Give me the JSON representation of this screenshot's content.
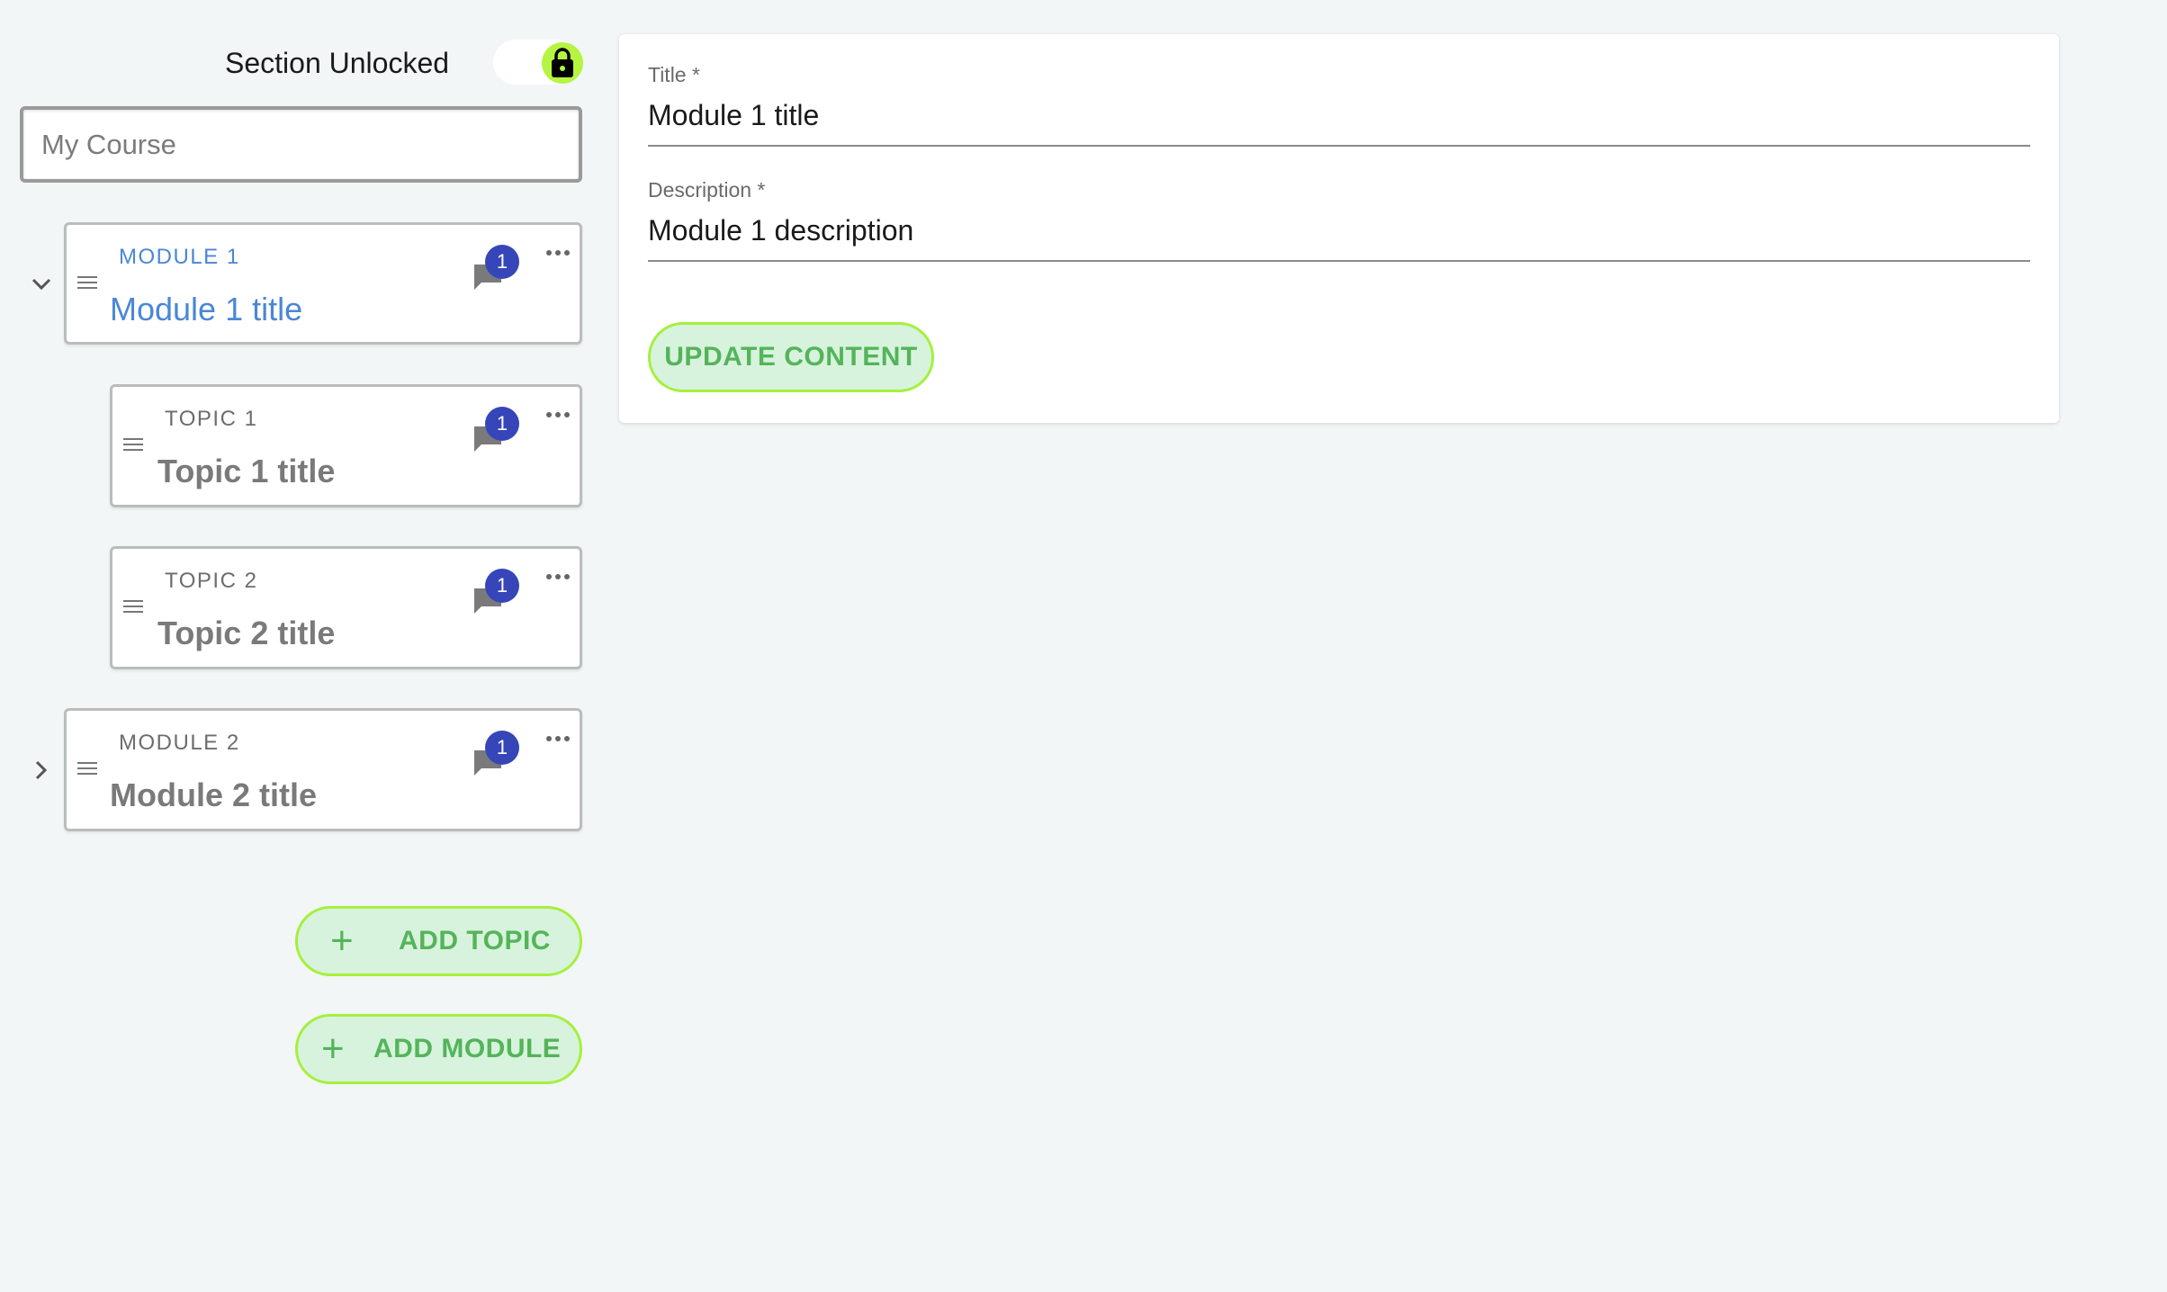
{
  "section": {
    "label": "Section Unlocked",
    "toggle_icon": "lock-icon",
    "toggle_color": "#b5f542"
  },
  "course_input": {
    "placeholder": "My Course",
    "value": ""
  },
  "tree": [
    {
      "overline": "MODULE 1",
      "title": "Module 1 title",
      "comment_count": "1",
      "expanded": true,
      "selected": true
    },
    {
      "overline": "TOPIC 1",
      "title": "Topic 1 title",
      "comment_count": "1"
    },
    {
      "overline": "TOPIC 2",
      "title": "Topic 2 title",
      "comment_count": "1"
    },
    {
      "overline": "MODULE 2",
      "title": "Module 2 title",
      "comment_count": "1",
      "expanded": false
    }
  ],
  "buttons": {
    "add_topic": "ADD TOPIC",
    "add_module": "ADD MODULE",
    "update_content": "UPDATE CONTENT"
  },
  "form": {
    "title_label": "Title *",
    "title_value": "Module 1 title",
    "description_label": "Description *",
    "description_value": "Module 1 description"
  },
  "colors": {
    "accent_blue": "#4a87d6",
    "badge": "#3646b8",
    "button_fill": "#d7f3dd",
    "button_border": "#a5f03c",
    "button_text": "#54b45a",
    "background": "#f2f6f6"
  }
}
